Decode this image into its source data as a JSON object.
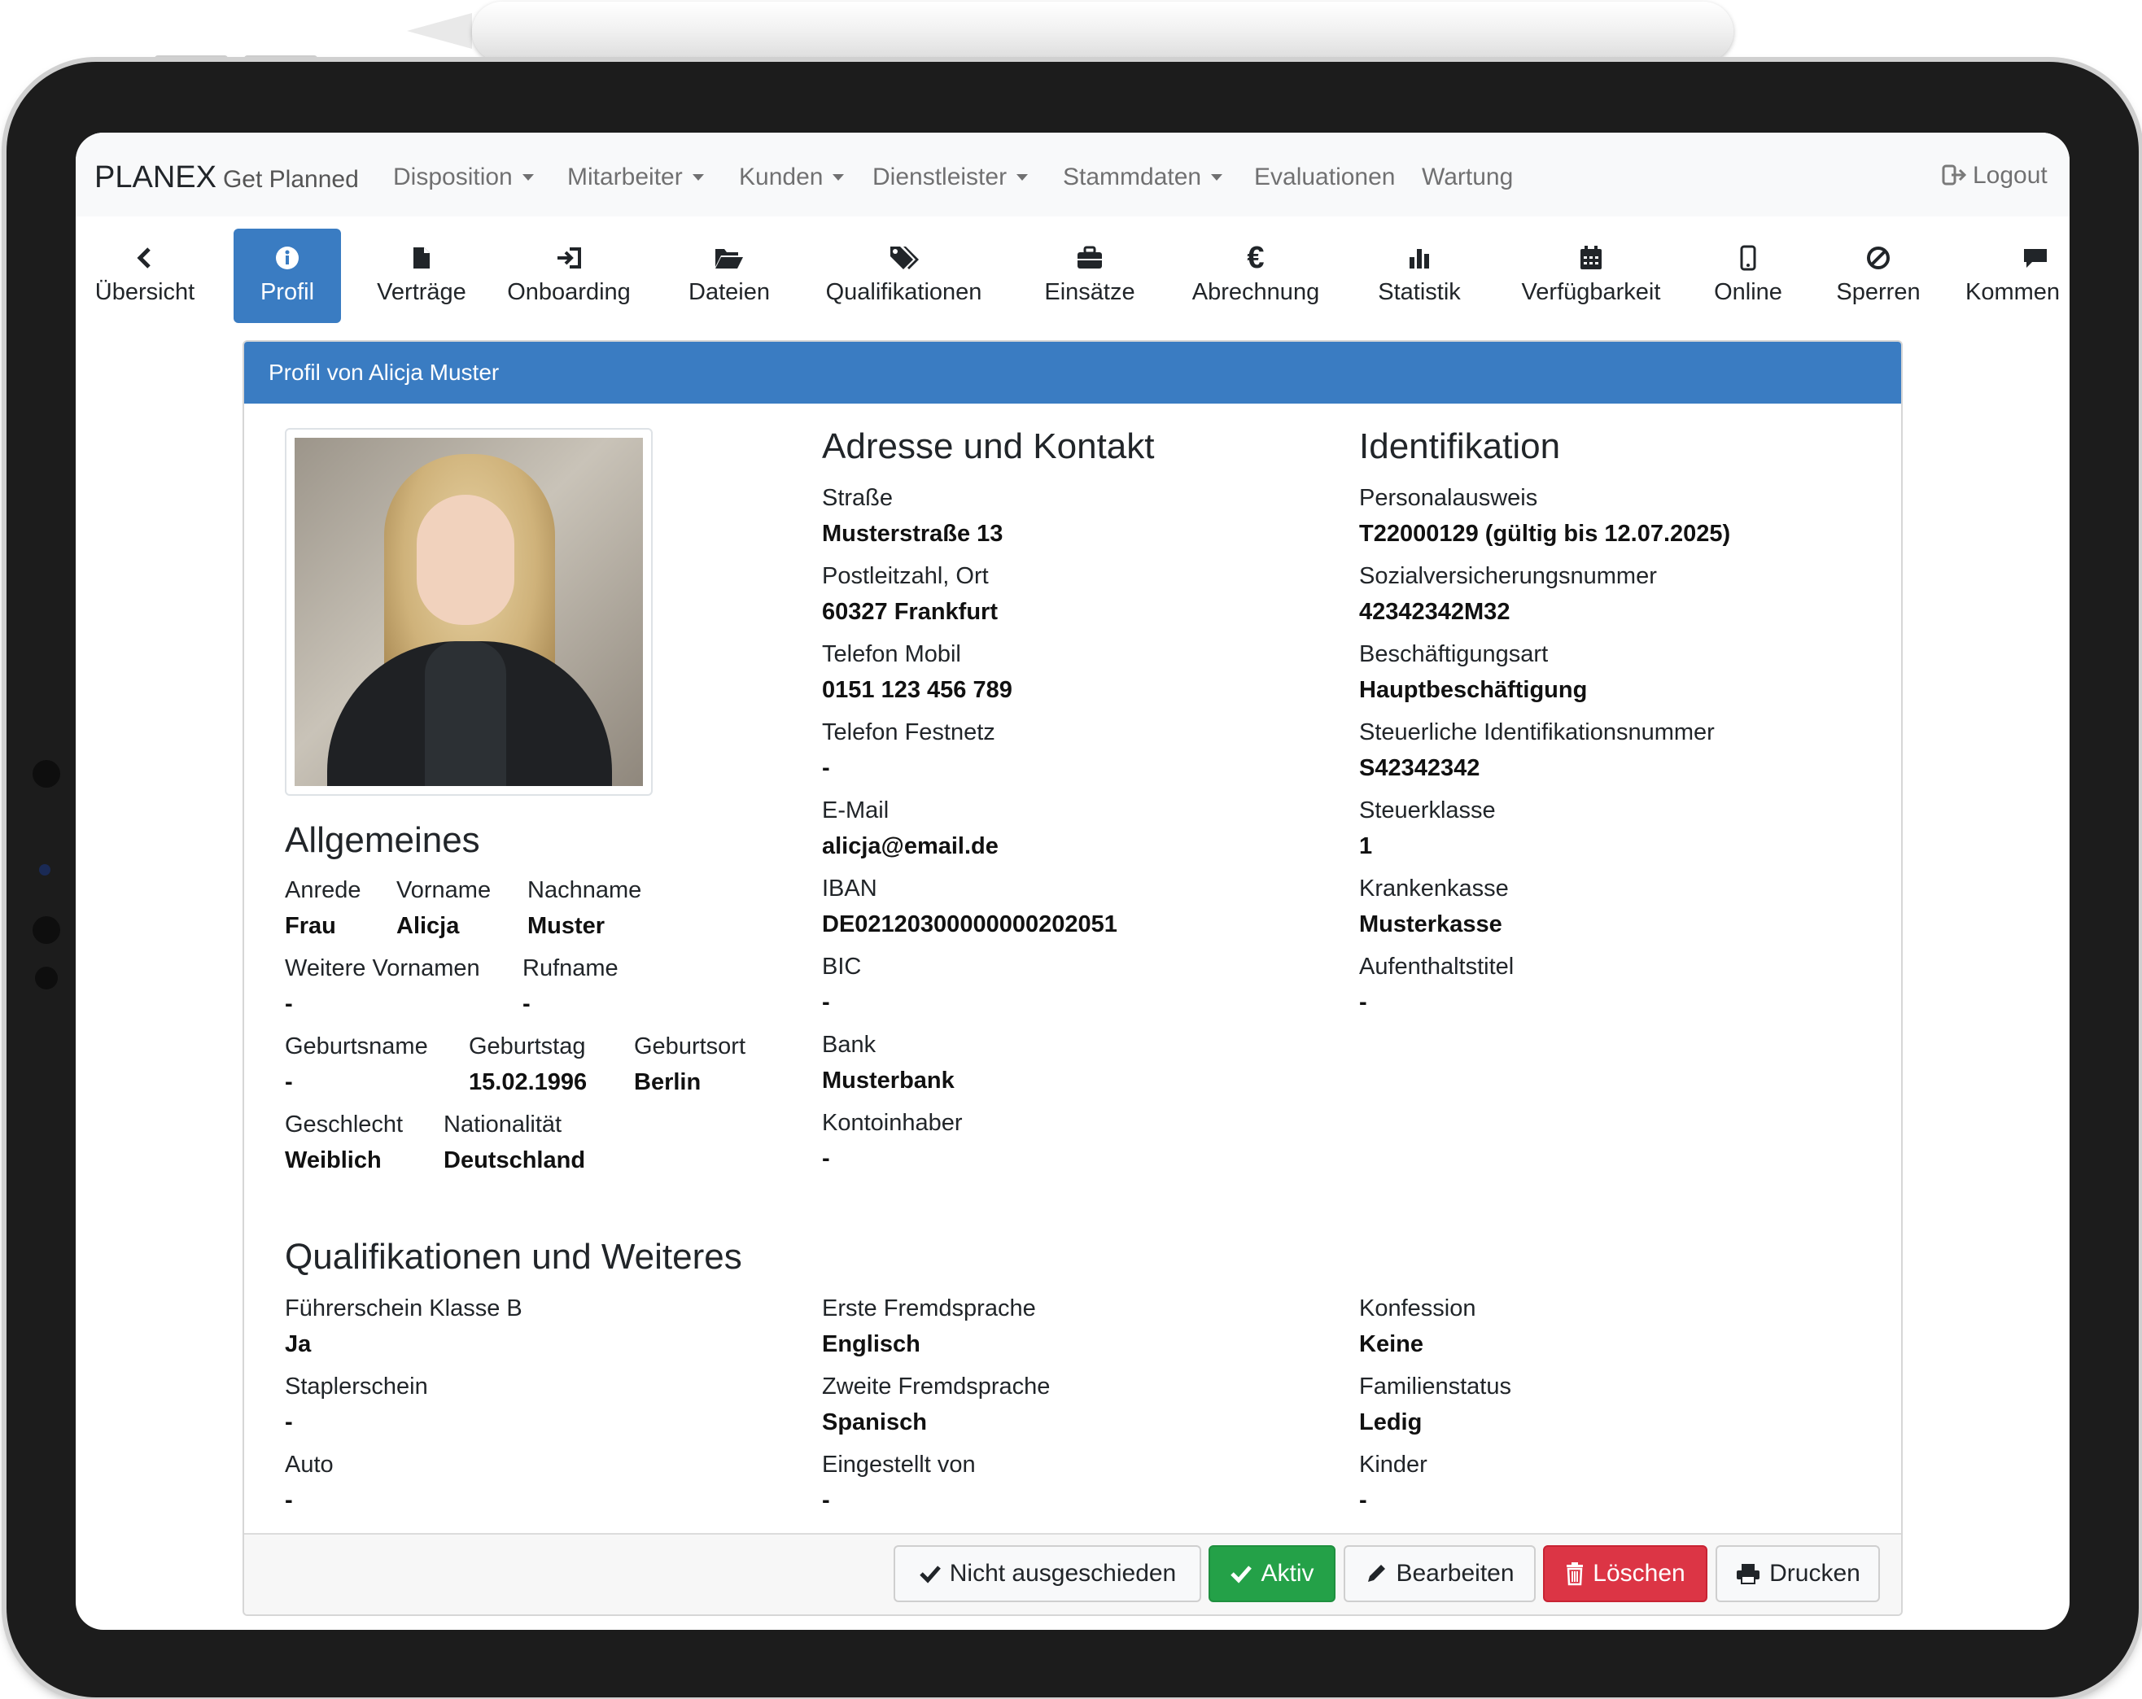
{
  "navbar": {
    "brand": "PLANEX",
    "brand_sub": "Get Planned",
    "items": [
      "Disposition",
      "Mitarbeiter",
      "Kunden",
      "Dienstleister",
      "Stammdaten",
      "Evaluationen",
      "Wartung"
    ],
    "logout": "Logout"
  },
  "tabs": [
    {
      "label": "Übersicht",
      "icon": "chevron-left-icon"
    },
    {
      "label": "Profil",
      "icon": "info-icon",
      "active": true
    },
    {
      "label": "Verträge",
      "icon": "file-icon"
    },
    {
      "label": "Onboarding",
      "icon": "sign-in-icon"
    },
    {
      "label": "Dateien",
      "icon": "folder-open-icon"
    },
    {
      "label": "Qualifikationen",
      "icon": "tags-icon"
    },
    {
      "label": "Einsätze",
      "icon": "briefcase-icon"
    },
    {
      "label": "Abrechnung",
      "icon": "euro-icon"
    },
    {
      "label": "Statistik",
      "icon": "bar-chart-icon"
    },
    {
      "label": "Verfügbarkeit",
      "icon": "calendar-icon"
    },
    {
      "label": "Online",
      "icon": "mobile-icon"
    },
    {
      "label": "Sperren",
      "icon": "ban-icon"
    },
    {
      "label": "Kommen",
      "icon": "comment-icon"
    }
  ],
  "card": {
    "title": "Profil von Alicja Muster"
  },
  "general": {
    "heading": "Allgemeines",
    "anrede": {
      "label": "Anrede",
      "value": "Frau"
    },
    "vorname": {
      "label": "Vorname",
      "value": "Alicja"
    },
    "nachname": {
      "label": "Nachname",
      "value": "Muster"
    },
    "weitere_vornamen": {
      "label": "Weitere Vornamen",
      "value": "-"
    },
    "rufname": {
      "label": "Rufname",
      "value": "-"
    },
    "geburtsname": {
      "label": "Geburtsname",
      "value": "-"
    },
    "geburtstag": {
      "label": "Geburtstag",
      "value": "15.02.1996"
    },
    "geburtsort": {
      "label": "Geburtsort",
      "value": "Berlin"
    },
    "geschlecht": {
      "label": "Geschlecht",
      "value": "Weiblich"
    },
    "nationalitaet": {
      "label": "Nationalität",
      "value": "Deutschland"
    }
  },
  "address": {
    "heading": "Adresse und Kontakt",
    "fields": [
      {
        "label": "Straße",
        "value": "Musterstraße 13"
      },
      {
        "label": "Postleitzahl, Ort",
        "value": "60327 Frankfurt"
      },
      {
        "label": "Telefon Mobil",
        "value": "0151 123 456 789"
      },
      {
        "label": "Telefon Festnetz",
        "value": "-"
      },
      {
        "label": "E-Mail",
        "value": "alicja@email.de"
      },
      {
        "label": "IBAN",
        "value": "DE02120300000000202051"
      },
      {
        "label": "BIC",
        "value": "-"
      },
      {
        "label": "Bank",
        "value": "Musterbank"
      },
      {
        "label": "Kontoinhaber",
        "value": "-"
      }
    ]
  },
  "identification": {
    "heading": "Identifikation",
    "fields": [
      {
        "label": "Personalausweis",
        "value": "T22000129 (gültig bis 12.07.2025)"
      },
      {
        "label": "Sozialversicherungsnummer",
        "value": "42342342M32"
      },
      {
        "label": "Beschäftigungsart",
        "value": "Hauptbeschäftigung"
      },
      {
        "label": "Steuerliche Identifikationsnummer",
        "value": "S42342342"
      },
      {
        "label": "Steuerklasse",
        "value": "1"
      },
      {
        "label": "Krankenkasse",
        "value": "Musterkasse"
      },
      {
        "label": "Aufenthaltstitel",
        "value": "-"
      }
    ]
  },
  "qualifications": {
    "heading": "Qualifikationen und Weiteres",
    "col1": [
      {
        "label": "Führerschein Klasse B",
        "value": "Ja"
      },
      {
        "label": "Staplerschein",
        "value": "-"
      },
      {
        "label": "Auto",
        "value": "-"
      }
    ],
    "col2": [
      {
        "label": "Erste Fremdsprache",
        "value": "Englisch"
      },
      {
        "label": "Zweite Fremdsprache",
        "value": "Spanisch"
      },
      {
        "label": "Eingestellt von",
        "value": "-"
      }
    ],
    "col3": [
      {
        "label": "Konfession",
        "value": "Keine"
      },
      {
        "label": "Familienstatus",
        "value": "Ledig"
      },
      {
        "label": "Kinder",
        "value": "-"
      }
    ]
  },
  "footer": {
    "not_left": "Nicht ausgeschieden",
    "active": "Aktiv",
    "edit": "Bearbeiten",
    "delete": "Löschen",
    "print": "Drucken"
  },
  "colors": {
    "primary": "#3a7cc2",
    "success": "#24a148",
    "danger": "#dc3545"
  }
}
